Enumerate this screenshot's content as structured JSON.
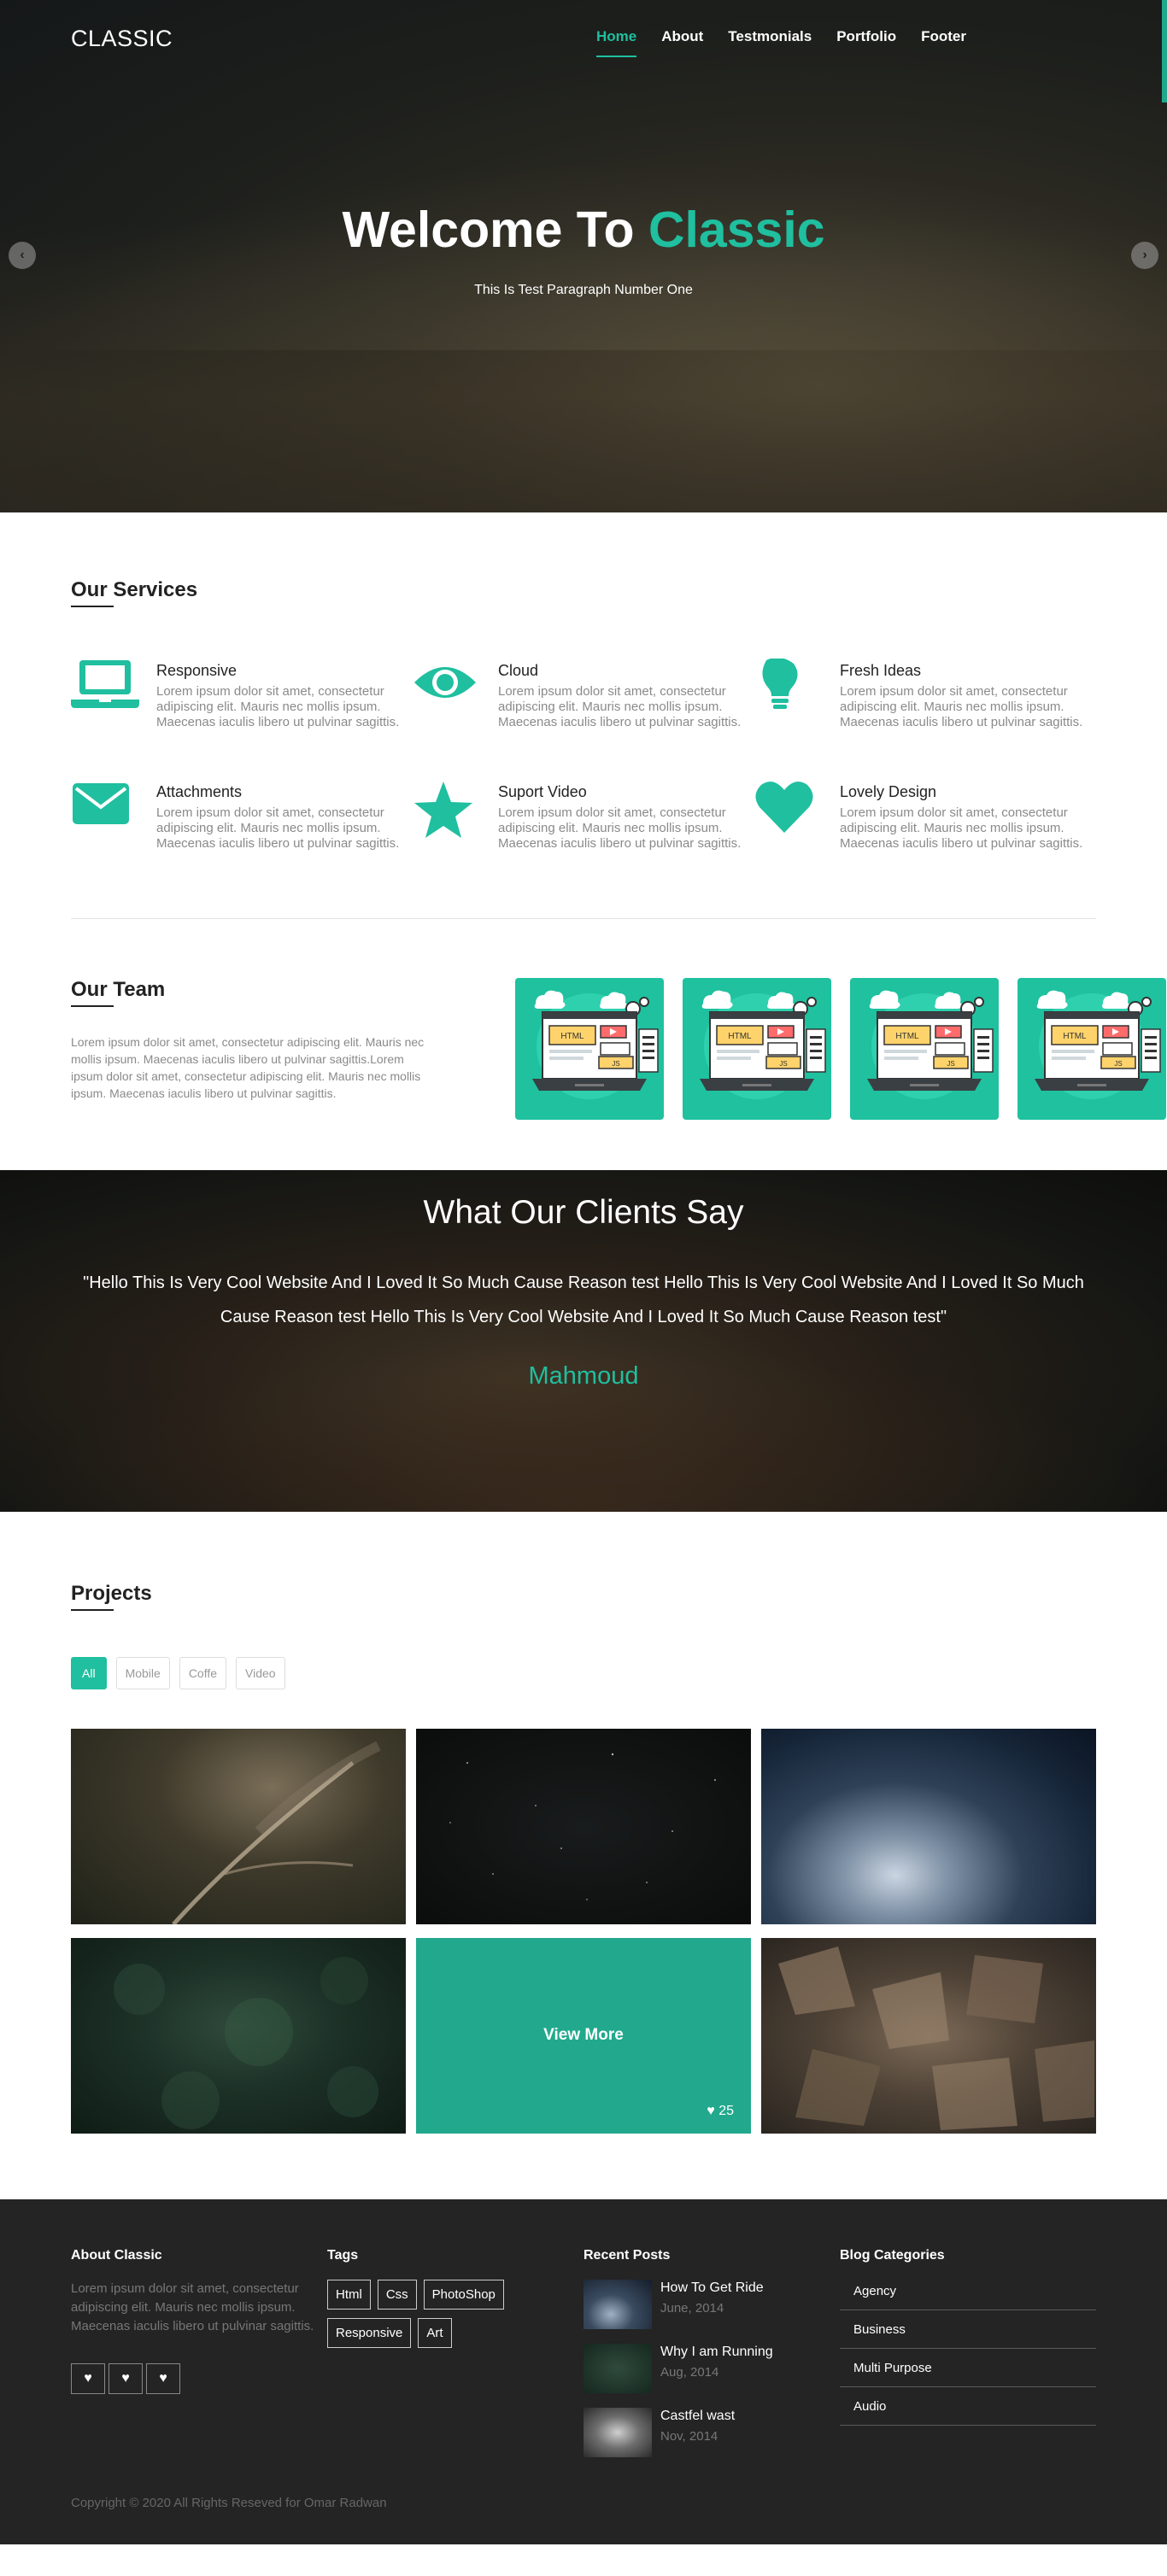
{
  "brand": {
    "name": "CLASSIC",
    "accent": "#1fbf9f"
  },
  "nav": {
    "items": [
      "Home",
      "About",
      "Testmonials",
      "Portfolio",
      "Footer"
    ],
    "active": "Home"
  },
  "hero": {
    "title_prefix": "Welcome To",
    "title_accent": "Classic",
    "subtitle": "This Is Test Paragraph Number One",
    "prev_icon": "chevron-left-icon",
    "next_icon": "chevron-right-icon"
  },
  "services": {
    "title": "Our Services",
    "items": [
      {
        "name": "Responsive",
        "icon": "laptop-icon",
        "text": "Lorem ipsum dolor sit amet, consectetur adipiscing elit. Mauris nec mollis ipsum. Maecenas iaculis libero ut pulvinar sagittis."
      },
      {
        "name": "Cloud",
        "icon": "eye-icon",
        "text": "Lorem ipsum dolor sit amet, consectetur adipiscing elit. Mauris nec mollis ipsum. Maecenas iaculis libero ut pulvinar sagittis."
      },
      {
        "name": "Fresh Ideas",
        "icon": "lightbulb-icon",
        "text": "Lorem ipsum dolor sit amet, consectetur adipiscing elit. Mauris nec mollis ipsum. Maecenas iaculis libero ut pulvinar sagittis."
      },
      {
        "name": "Attachments",
        "icon": "envelope-icon",
        "text": "Lorem ipsum dolor sit amet, consectetur adipiscing elit. Mauris nec mollis ipsum. Maecenas iaculis libero ut pulvinar sagittis."
      },
      {
        "name": "Suport Video",
        "icon": "star-icon",
        "text": "Lorem ipsum dolor sit amet, consectetur adipiscing elit. Mauris nec mollis ipsum. Maecenas iaculis libero ut pulvinar sagittis."
      },
      {
        "name": "Lovely Design",
        "icon": "heart-icon",
        "text": "Lorem ipsum dolor sit amet, consectetur adipiscing elit. Mauris nec mollis ipsum. Maecenas iaculis libero ut pulvinar sagittis."
      }
    ]
  },
  "team": {
    "title": "Our Team",
    "text": "Lorem ipsum dolor sit amet, consectetur adipiscing elit. Mauris nec mollis ipsum. Maecenas iaculis libero ut pulvinar sagittis.Lorem ipsum dolor sit amet, consectetur adipiscing elit. Mauris nec mollis ipsum. Maecenas iaculis libero ut pulvinar sagittis.",
    "cards": [
      {
        "html": "HTML",
        "js": "JS"
      },
      {
        "html": "HTML",
        "js": "JS"
      },
      {
        "html": "HTML",
        "js": "JS"
      },
      {
        "html": "HTML",
        "js": "JS"
      }
    ]
  },
  "testimonials": {
    "title": "What Our Clients Say",
    "quote": "\"Hello This Is Very Cool Website And I Loved It So Much Cause Reason test Hello This Is Very Cool Website And I Loved It So Much Cause Reason test Hello This Is Very Cool Website And I Loved It So Much Cause Reason test\"",
    "author": "Mahmoud"
  },
  "projects": {
    "title": "Projects",
    "filters": [
      "All",
      "Mobile",
      "Coffe",
      "Video"
    ],
    "active_filter": "All",
    "view_more": "View More",
    "likes": "25",
    "likes_icon": "heart-icon"
  },
  "footer": {
    "about": {
      "title": "About Classic",
      "text": "Lorem ipsum dolor sit amet, consectetur adipiscing elit. Mauris nec mollis ipsum. Maecenas iaculis libero ut pulvinar sagittis.",
      "social_icons": [
        "heart-icon",
        "heart-icon",
        "heart-icon"
      ]
    },
    "tags": {
      "title": "Tags",
      "items": [
        "Html",
        "Css",
        "PhotoShop",
        "Responsive",
        "Art"
      ]
    },
    "posts": {
      "title": "Recent Posts",
      "items": [
        {
          "title": "How To Get Ride",
          "date": "June, 2014"
        },
        {
          "title": "Why I am Running",
          "date": "Aug, 2014"
        },
        {
          "title": "Castfel wast",
          "date": "Nov, 2014"
        }
      ]
    },
    "categories": {
      "title": "Blog Categories",
      "items": [
        "Agency",
        "Business",
        "Multi Purpose",
        "Audio"
      ]
    },
    "copyright": "Copyright © 2020 All Rights Reseved for Omar Radwan"
  }
}
